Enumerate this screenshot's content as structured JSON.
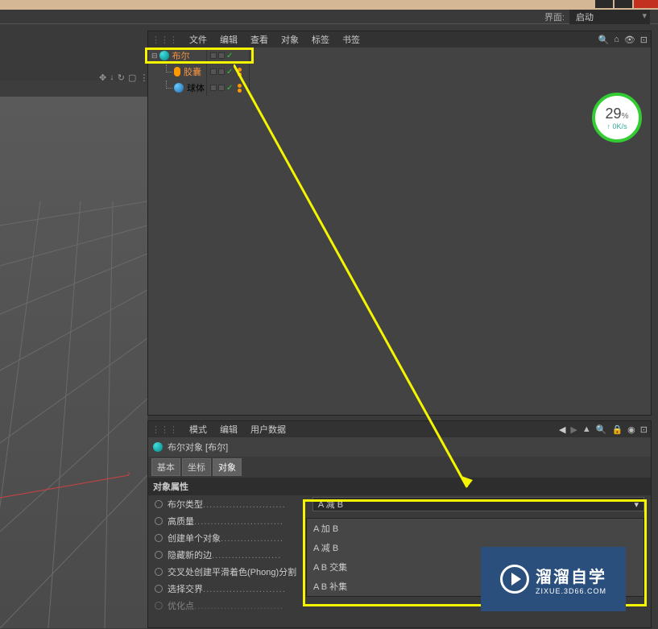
{
  "header": {
    "interface_label": "界面:",
    "interface_selected": "启动"
  },
  "object_panel": {
    "menu": {
      "file": "文件",
      "edit": "编辑",
      "view": "查看",
      "object": "对象",
      "tags": "标签",
      "bookmark": "书签"
    },
    "tree": [
      {
        "name": "布尔",
        "color": "#f59342",
        "icon": "bool"
      },
      {
        "name": "胶囊",
        "color": "#f59342",
        "icon": "capsule"
      },
      {
        "name": "球体",
        "color": "#ccc",
        "icon": "sphere"
      }
    ]
  },
  "attribute_panel": {
    "menu": {
      "mode": "模式",
      "edit": "编辑",
      "userdata": "用户数据"
    },
    "title": "布尔对象 [布尔]",
    "tabs": {
      "basic": "基本",
      "coord": "坐标",
      "object": "对象"
    },
    "section_title": "对象属性",
    "rows": {
      "bool_type": "布尔类型",
      "high_quality": "高质量",
      "create_single": "创建单个对象",
      "hide_edges": "隐藏新的边",
      "phong_split": "交叉处创建平滑着色(Phong)分割",
      "select_intersect": "选择交界",
      "optimize": "优化点"
    },
    "dropdown_selected": "A 减 B",
    "dropdown_options": [
      "A 加 B",
      "A 减 B",
      "A B 交集",
      "A B 补集"
    ]
  },
  "speed_widget": {
    "value": "29",
    "percent": "%",
    "rate": "↑ 0K/s"
  },
  "watermark": {
    "main": "溜溜自学",
    "sub": "ZIXUE.3D66.COM"
  }
}
